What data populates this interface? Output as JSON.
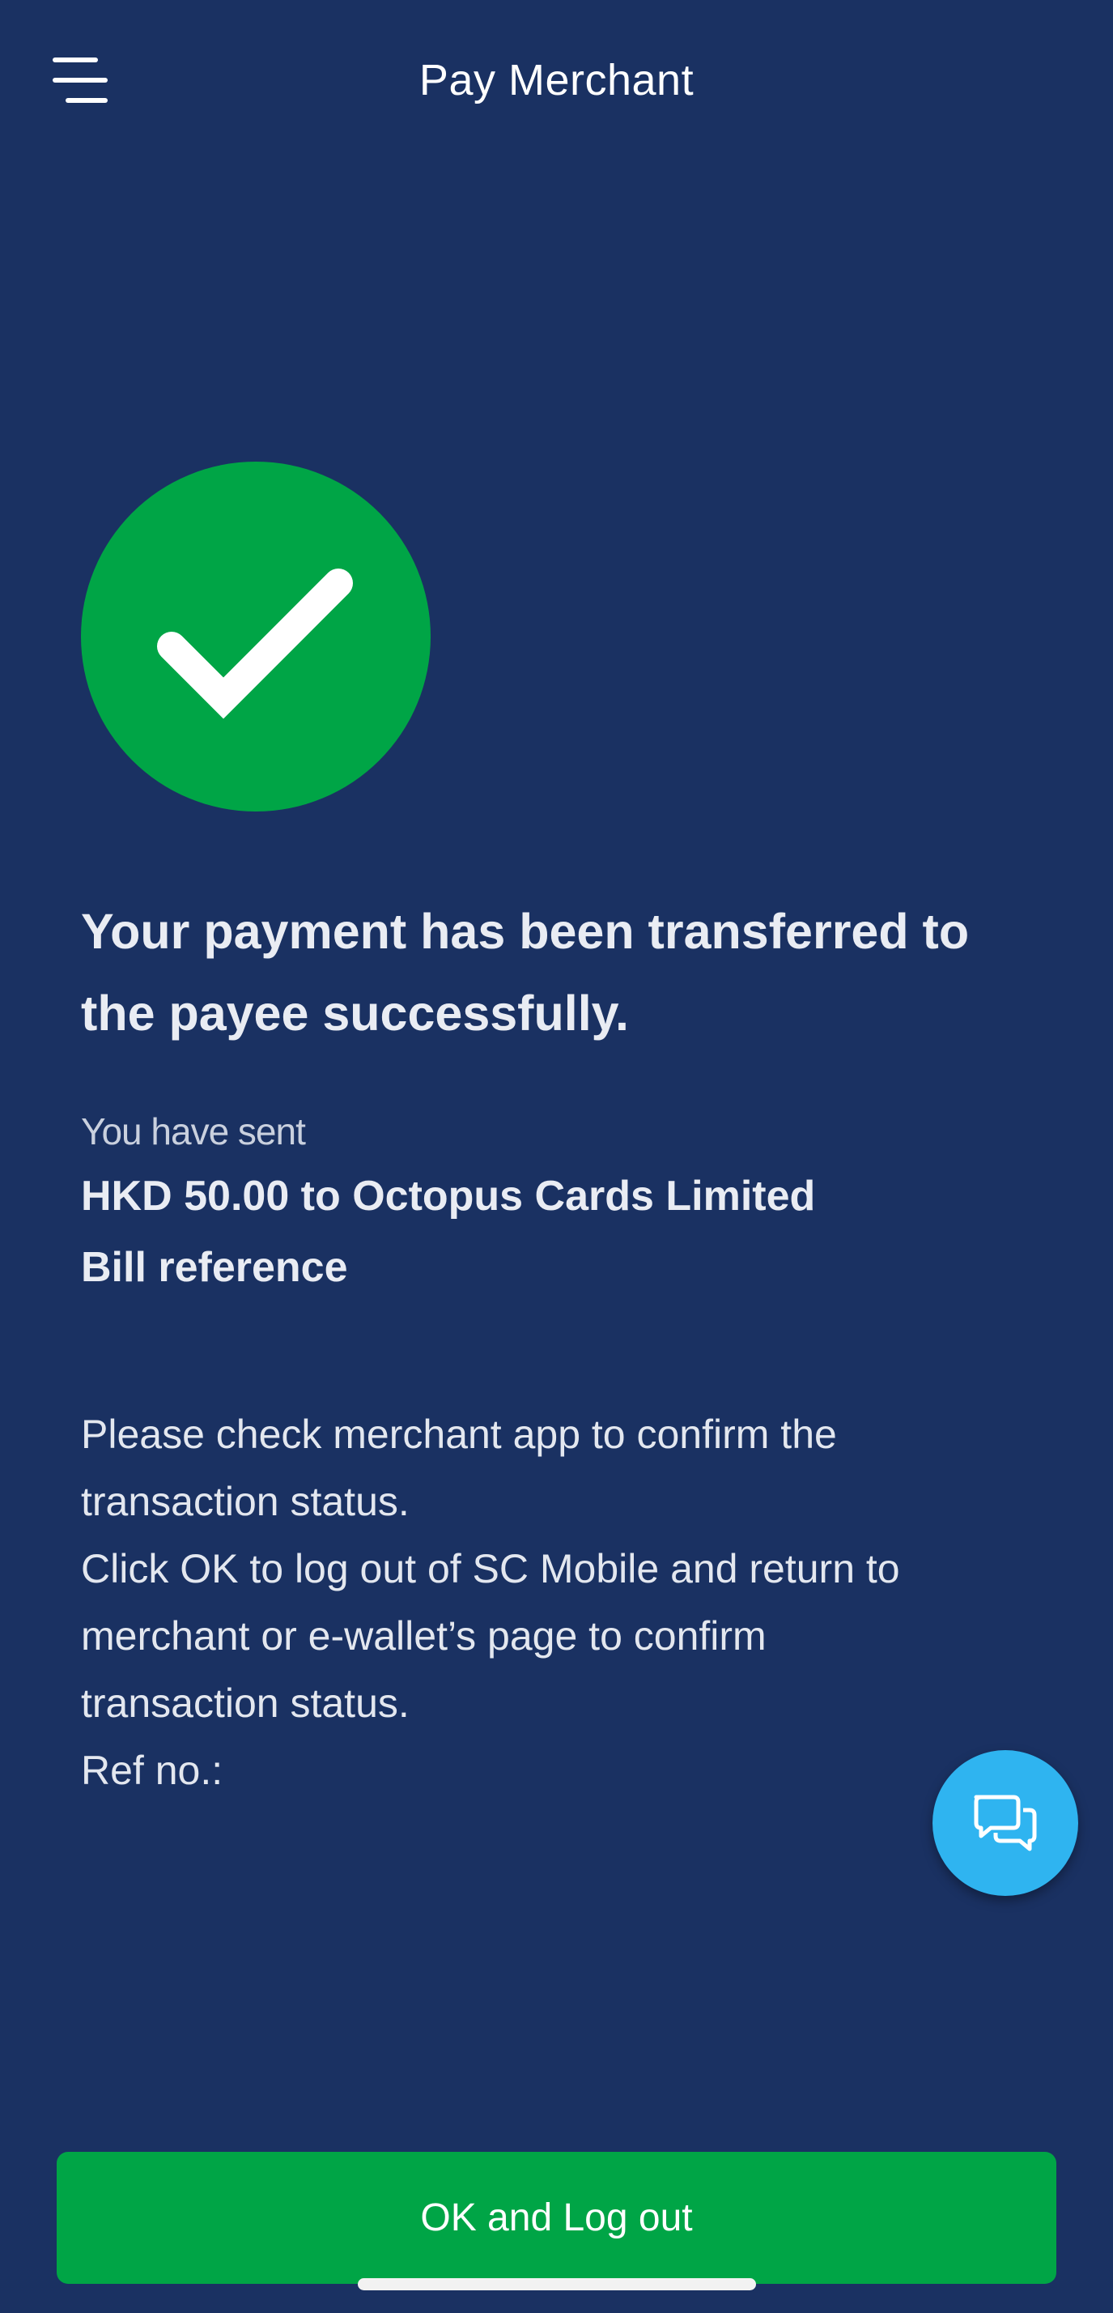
{
  "header": {
    "title": "Pay Merchant",
    "menu_icon": "menu-icon"
  },
  "status": {
    "icon": "checkmark-circle-icon",
    "icon_color": "#00a546",
    "headline_line1": "Your payment has been transferred to",
    "headline_line2": "the payee successfully."
  },
  "details": {
    "sent_label": "You have sent",
    "amount_line": "HKD 50.00 to Octopus Cards Limited",
    "bill_reference_label": "Bill reference"
  },
  "info": {
    "lines": [
      "Please check merchant app to confirm the",
      "transaction status.",
      "Click OK to log out of SC Mobile and return to",
      "merchant or e-wallet’s page to confirm",
      "transaction status.",
      "Ref no.:"
    ]
  },
  "chat": {
    "icon": "chat-bubbles-icon",
    "color": "#2fb4f0"
  },
  "footer": {
    "ok_button_label": "OK and Log out",
    "button_color": "#00a546"
  },
  "theme": {
    "background": "#1a3162"
  }
}
